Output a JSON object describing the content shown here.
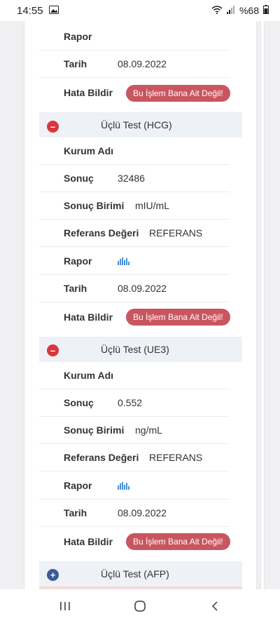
{
  "status": {
    "time": "14:55",
    "battery": "%68"
  },
  "top": {
    "rapor_label": "Rapor",
    "tarih_label": "Tarih",
    "tarih_value": "08.09.2022",
    "hata_label": "Hata Bildir",
    "hata_button": "Bu İşlem Bana Ait Değil!"
  },
  "sections": [
    {
      "title": "Üçlü Test (HCG)",
      "expanded": true,
      "kurum_label": "Kurum Adı",
      "sonuc_label": "Sonuç",
      "sonuc_value": "32486",
      "birim_label": "Sonuç Birimi",
      "birim_value": "mIU/mL",
      "referans_label": "Referans Değeri",
      "referans_value": "REFERANS",
      "rapor_label": "Rapor",
      "rapor_icon": "bar-chart-icon",
      "tarih_label": "Tarih",
      "tarih_value": "08.09.2022",
      "hata_label": "Hata Bildir",
      "hata_button": "Bu İşlem Bana Ait Değil!"
    },
    {
      "title": "Üçlü Test (UE3)",
      "expanded": true,
      "kurum_label": "Kurum Adı",
      "sonuc_label": "Sonuç",
      "sonuc_value": "0.552",
      "birim_label": "Sonuç Birimi",
      "birim_value": "ng/mL",
      "referans_label": "Referans Değeri",
      "referans_value": "REFERANS",
      "rapor_label": "Rapor",
      "rapor_icon": "bar-chart-icon",
      "tarih_label": "Tarih",
      "tarih_value": "08.09.2022",
      "hata_label": "Hata Bildir",
      "hata_button": "Bu İşlem Bana Ait Değil!"
    },
    {
      "title": "Üçlü Test (AFP)",
      "expanded": false
    }
  ],
  "colors": {
    "minus_toggle": "#d9363e",
    "plus_toggle": "#3d5a98",
    "error_button": "#c9565f",
    "section_header_bg": "#eef1f6",
    "chart_icon": "#4a90d9"
  },
  "nav": {
    "recents_icon": "recents-icon",
    "home_icon": "home-icon",
    "back_icon": "back-icon"
  }
}
